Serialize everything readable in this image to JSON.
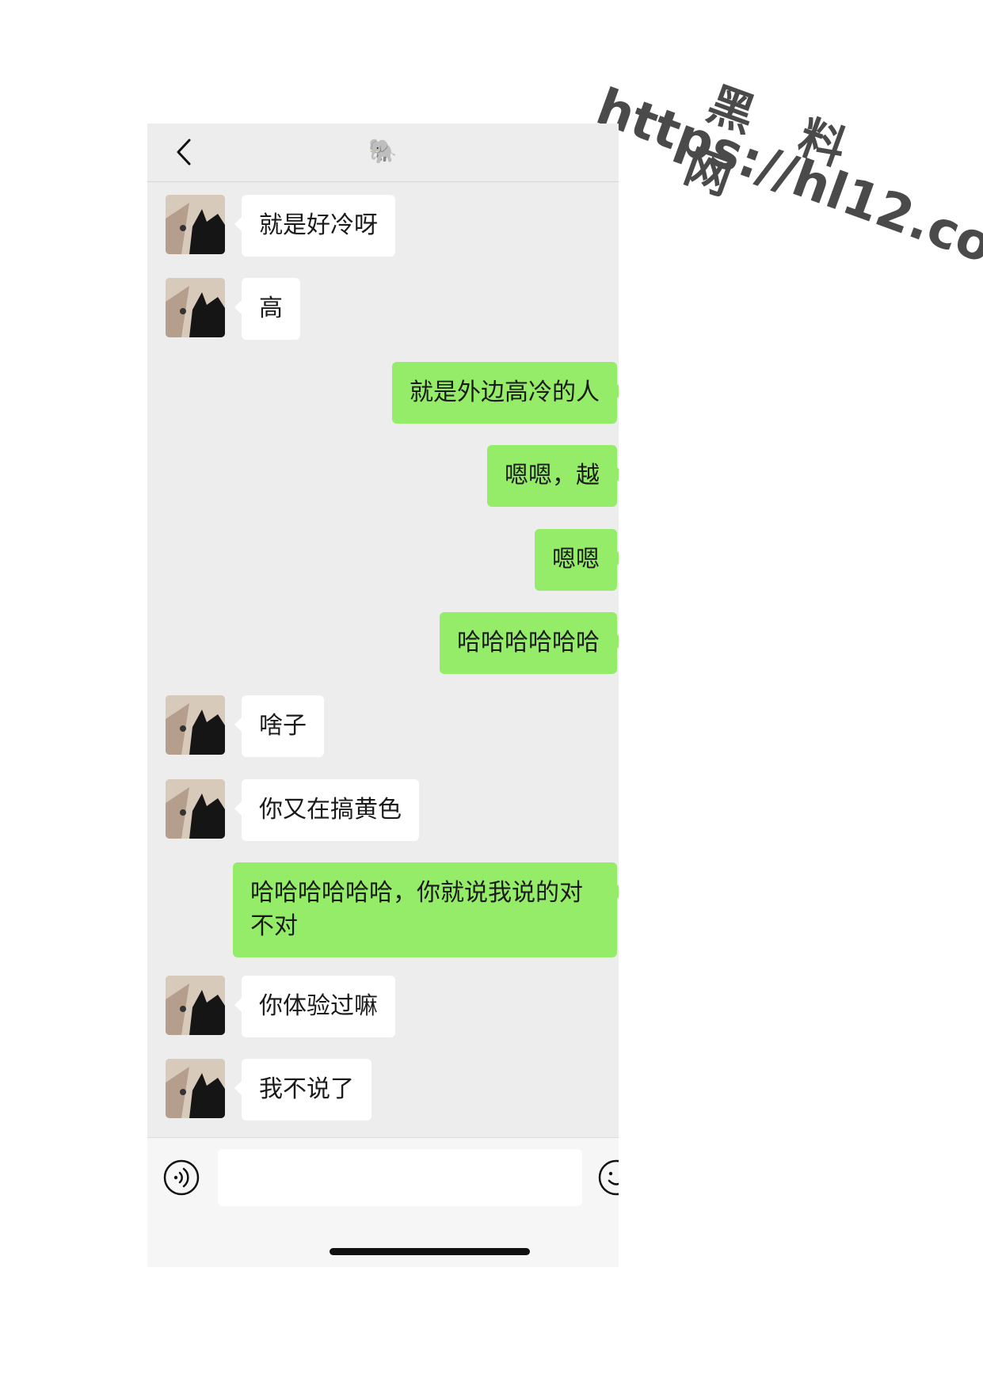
{
  "watermark": {
    "site": "黑 料 网",
    "url": "https://hl12.co"
  },
  "header": {
    "title": "🐘",
    "back_icon": "chevron-left-icon"
  },
  "messages": [
    {
      "side": "in",
      "text": "就是好冷呀"
    },
    {
      "side": "in",
      "text": "高"
    },
    {
      "side": "out",
      "text": "就是外边高冷的人"
    },
    {
      "side": "out",
      "text": "嗯嗯，越"
    },
    {
      "side": "out",
      "text": "嗯嗯"
    },
    {
      "side": "out",
      "text": "哈哈哈哈哈哈"
    },
    {
      "side": "in",
      "text": "啥子"
    },
    {
      "side": "in",
      "text": "你又在搞黄色"
    },
    {
      "side": "out",
      "text": "哈哈哈哈哈哈，你就说我说的对不对"
    },
    {
      "side": "in",
      "text": "你体验过嘛"
    },
    {
      "side": "in",
      "text": "我不说了"
    }
  ],
  "composer": {
    "value": "",
    "voice_icon": "voice-icon",
    "emoji_icon": "emoji-icon"
  },
  "colors": {
    "outgoing": "#95ec69",
    "incoming": "#ffffff",
    "background": "#ededed"
  }
}
